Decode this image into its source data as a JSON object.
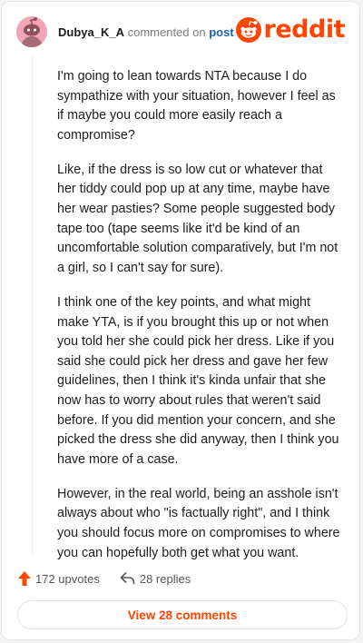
{
  "comment": {
    "author": "Dubya_K_A",
    "commented_on_text": "commented on",
    "target": "post",
    "avatar_icon": "snoo-avatar-icon",
    "paragraphs": [
      "I'm going to lean towards NTA because I do sympathize with your situation, however I feel as if maybe you could more easily reach a compromise?",
      "Like, if the dress is so low cut or whatever that her tiddy could pop up at any time, maybe have her wear pasties? Some people suggested body tape too (tape seems like it'd be kind of an uncomfortable solution comparatively, but I'm not a girl, so I can't say for sure).",
      "I think one of the key points, and what might make YTA, is if you brought this up or not when you told her she could pick her dress. Like if you said she could pick her dress and gave her few guidelines, then I think it's kinda unfair that she now has to worry about rules that weren't said before. If you did mention your concern, and she picked the dress she did anyway, then I think you have more of a case.",
      "However, in the real world, being an asshole isn't always about who \"is factually right\", and I think you should focus more on compromises to where you can hopefully both get what you want."
    ]
  },
  "brand": {
    "wordmark": "reddit",
    "color": "#ff4500"
  },
  "actions": {
    "upvotes": "172 upvotes",
    "replies": "28 replies"
  },
  "view_comments_label": "View 28 comments"
}
